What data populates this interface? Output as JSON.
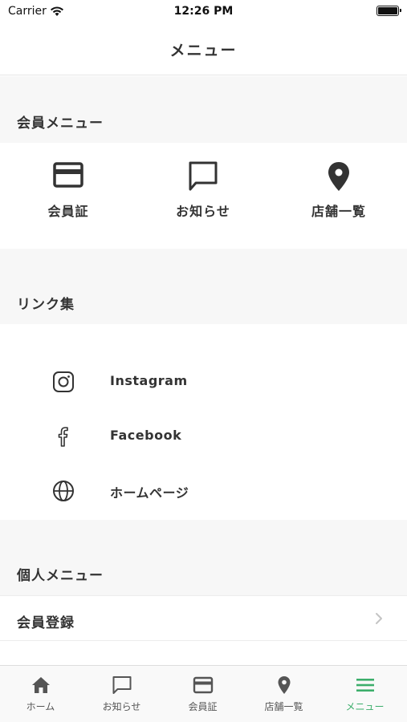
{
  "status_bar": {
    "carrier": "Carrier",
    "time": "12:26 PM"
  },
  "nav": {
    "title": "メニュー"
  },
  "member_menu": {
    "header": "会員メニュー",
    "items": [
      {
        "label": "会員証",
        "icon": "card-icon"
      },
      {
        "label": "お知らせ",
        "icon": "chat-icon"
      },
      {
        "label": "店舗一覧",
        "icon": "map-pin-icon"
      }
    ]
  },
  "links": {
    "header": "リンク集",
    "items": [
      {
        "label": "Instagram",
        "icon": "instagram-icon"
      },
      {
        "label": "Facebook",
        "icon": "facebook-icon"
      },
      {
        "label": "ホームページ",
        "icon": "globe-icon"
      }
    ]
  },
  "personal_menu": {
    "header": "個人メニュー",
    "items": [
      {
        "label": "会員登録"
      }
    ]
  },
  "tab_bar": {
    "tabs": [
      {
        "label": "ホーム",
        "icon": "home-icon"
      },
      {
        "label": "お知らせ",
        "icon": "chat-icon"
      },
      {
        "label": "会員証",
        "icon": "card-icon"
      },
      {
        "label": "店舗一覧",
        "icon": "map-pin-icon"
      },
      {
        "label": "メニュー",
        "icon": "menu-icon"
      }
    ],
    "active_index": 4
  },
  "colors": {
    "accent": "#3cae6b",
    "text": "#333333",
    "section_bg": "#f7f7f7"
  }
}
